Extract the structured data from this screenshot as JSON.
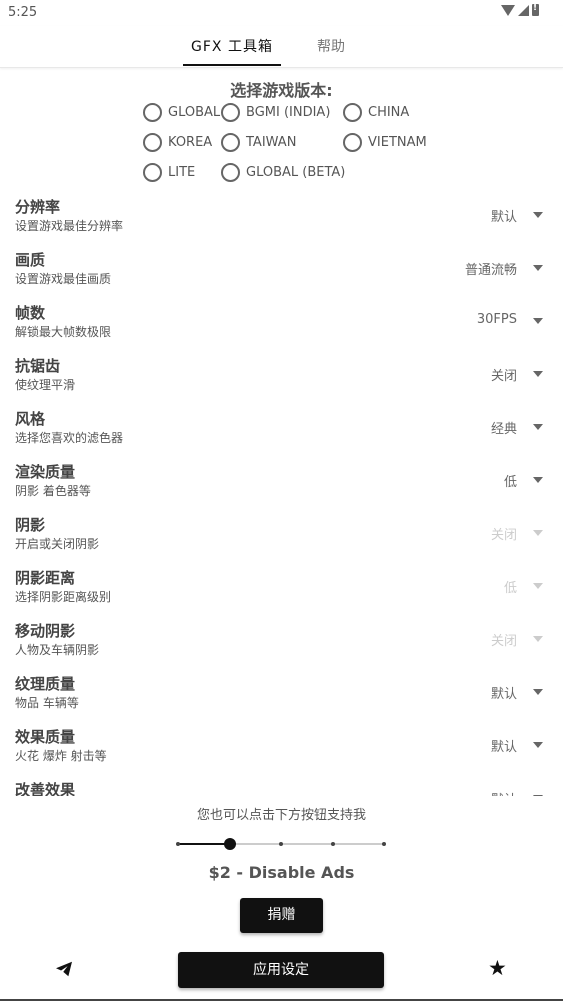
{
  "status_bar": {
    "time": "5:25"
  },
  "tabs": [
    {
      "label": "GFX 工具箱",
      "selected": true
    },
    {
      "label": "帮助",
      "selected": false
    }
  ],
  "version_section": {
    "title": "选择游戏版本:",
    "options": [
      {
        "label": "GLOBAL",
        "checked": false
      },
      {
        "label": "BGMI (INDIA)",
        "checked": false
      },
      {
        "label": "CHINA",
        "checked": false
      },
      {
        "label": "KOREA",
        "checked": false
      },
      {
        "label": "TAIWAN",
        "checked": false
      },
      {
        "label": "VIETNAM",
        "checked": false
      },
      {
        "label": "LITE",
        "checked": false
      },
      {
        "label": "GLOBAL (BETA)",
        "checked": false
      }
    ]
  },
  "settings": [
    {
      "title": "分辨率",
      "desc": "设置游戏最佳分辨率",
      "value": "默认",
      "enabled": true
    },
    {
      "title": "画质",
      "desc": "设置游戏最佳画质",
      "value": "普通流畅",
      "enabled": true
    },
    {
      "title": "帧数",
      "desc": "解锁最大帧数极限",
      "value": "30FPS",
      "enabled": true
    },
    {
      "title": "抗锯齿",
      "desc": "使纹理平滑",
      "value": "关闭",
      "enabled": true
    },
    {
      "title": "风格",
      "desc": "选择您喜欢的滤色器",
      "value": "经典",
      "enabled": true
    },
    {
      "title": "渲染质量",
      "desc": "阴影 着色器等",
      "value": "低",
      "enabled": true
    },
    {
      "title": "阴影",
      "desc": "开启或关闭阴影",
      "value": "关闭",
      "enabled": false
    },
    {
      "title": "阴影距离",
      "desc": "选择阴影距离级别",
      "value": "低",
      "enabled": false
    },
    {
      "title": "移动阴影",
      "desc": "人物及车辆阴影",
      "value": "关闭",
      "enabled": false
    },
    {
      "title": "纹理质量",
      "desc": "物品 车辆等",
      "value": "默认",
      "enabled": true
    },
    {
      "title": "效果质量",
      "desc": "火花 爆炸 射击等",
      "value": "默认",
      "enabled": true
    },
    {
      "title": "改善效果",
      "desc": "",
      "value": "默认",
      "enabled": true
    }
  ],
  "support": {
    "text": "您也可以点击下方按钮支持我",
    "slider": {
      "steps": 5,
      "selected_index": 1
    },
    "price_label": "$2 - Disable Ads",
    "donate_label": "捐赠"
  },
  "bottom_bar": {
    "apply_label": "应用设定",
    "left_icon": "telegram-icon",
    "right_icon": "star-icon"
  }
}
